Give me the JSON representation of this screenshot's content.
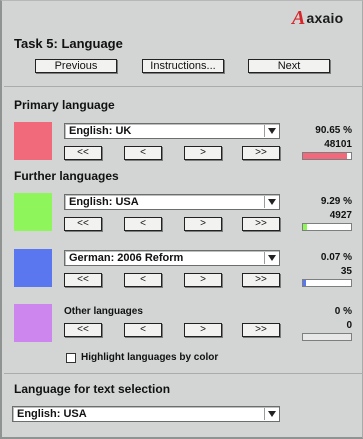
{
  "brand": {
    "logo_mark": "A",
    "logo_text": "axaio"
  },
  "task": {
    "title": "Task 5: Language"
  },
  "nav": {
    "previous_label": "Previous",
    "instructions_label": "Instructions...",
    "next_label": "Next"
  },
  "primary": {
    "heading": "Primary language",
    "language": "English: UK",
    "color": "#f06a7c",
    "percent": "90.65 %",
    "count": "48101",
    "fill_fraction": 0.9065,
    "buttons": [
      "<<",
      "<",
      ">",
      ">>"
    ]
  },
  "further": {
    "heading": "Further languages",
    "items": [
      {
        "language": "English: USA",
        "color": "#8ef55a",
        "percent": "9.29 %",
        "count": "4927",
        "fill_fraction": 0.0929,
        "buttons": [
          "<<",
          "<",
          ">",
          ">>"
        ]
      },
      {
        "language": "German: 2006 Reform",
        "color": "#5b77ef",
        "percent": "0.07 %",
        "count": "35",
        "fill_fraction": 0.0007,
        "buttons": [
          "<<",
          "<",
          ">",
          ">>"
        ]
      }
    ]
  },
  "other": {
    "label": "Other languages",
    "color": "#cc86ee",
    "percent": "0 %",
    "count": "0",
    "fill_fraction": 0,
    "buttons": [
      "<<",
      "<",
      ">",
      ">>"
    ]
  },
  "highlight": {
    "label": "Highlight languages by color",
    "checked": false
  },
  "text_selection": {
    "heading": "Language for text selection",
    "language": "English: USA"
  }
}
